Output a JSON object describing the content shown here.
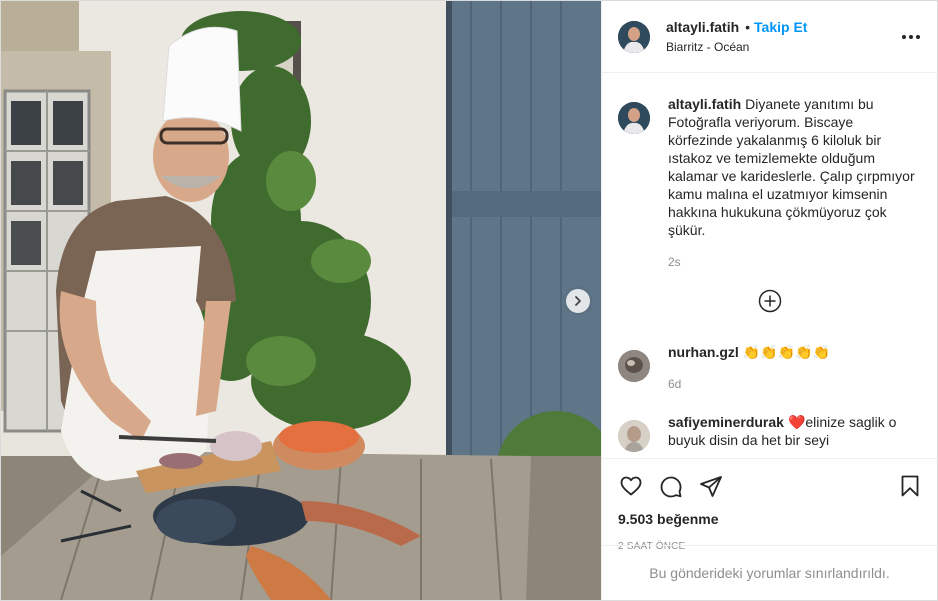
{
  "post": {
    "author": {
      "username": "altayli.fatih",
      "follow_label": "Takip Et",
      "separator": "•",
      "location": "Biarritz - Océan"
    },
    "caption": {
      "username": "altayli.fatih",
      "text": "Diyanete yanıtımı bu Fotoğrafla veriyorum. Biscaye körfezinde yakalanmış 6 kiloluk bir ıstakoz ve temizlemekte olduğum kalamar ve karideslerle. Çalıp çırpmıyor kamu malına el uzatmıyor kimsenin hakkına hukukuna çökmüyoruz çok şükür.",
      "time": "2s"
    },
    "comments": [
      {
        "username": "nurhan.gzl",
        "text": "👏👏👏👏👏",
        "time": "6d"
      },
      {
        "username": "safiyeminerdurak",
        "text": "❤️elinize saglik o buyuk disin da het bir seyi",
        "time": ""
      }
    ],
    "likes_count": "9.503",
    "likes_label": "beğenme",
    "posted_ago": "2 SAAT ÖNCE",
    "comments_restricted": "Bu gönderideki yorumlar sınırlandırıldı.",
    "icons": {
      "more": "more-options-icon",
      "next": "chevron-right-icon",
      "load_more": "plus-circle-icon",
      "like": "heart-icon",
      "comment": "comment-bubble-icon",
      "share": "paper-plane-icon",
      "save": "bookmark-icon"
    },
    "colors": {
      "link": "#0095f6",
      "text": "#262626",
      "muted": "#8e8e8e",
      "border": "#dbdbdb"
    }
  }
}
